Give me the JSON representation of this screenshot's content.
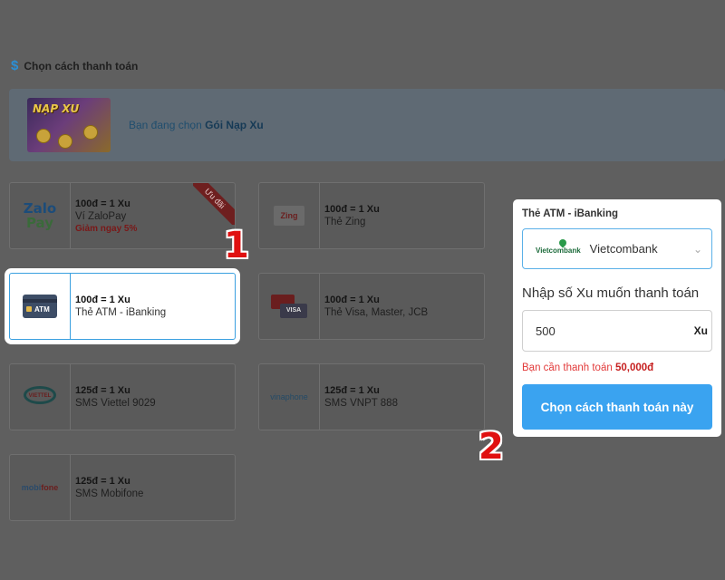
{
  "section": {
    "icon": "dollar-icon",
    "title": "Chọn cách thanh toán"
  },
  "banner": {
    "image_text": "NẠP XU",
    "text_prefix": "Bạn đang chọn",
    "package": "Gói Nạp Xu"
  },
  "methods": [
    {
      "id": "zalopay",
      "logo": "zalopay-logo",
      "logo_top": "Zalo",
      "logo_bottom": "Pay",
      "rate": "100đ = 1 Xu",
      "name": "Ví ZaloPay",
      "promo": "Giảm ngay 5%",
      "ribbon": "Ưu đãi",
      "selected": false
    },
    {
      "id": "zing",
      "logo": "zing-logo",
      "logo_text": "Zing",
      "rate": "100đ = 1 Xu",
      "name": "Thẻ Zing",
      "selected": false
    },
    {
      "id": "atm",
      "logo": "atm-card-icon",
      "logo_text": "ATM",
      "rate": "100đ = 1 Xu",
      "name": "Thẻ ATM - iBanking",
      "selected": true
    },
    {
      "id": "visa",
      "logo": "visa-mastercard-logo",
      "logo_text": "VISA",
      "rate": "100đ = 1 Xu",
      "name": "Thẻ Visa, Master, JCB",
      "selected": false
    },
    {
      "id": "viettel",
      "logo": "viettel-logo",
      "logo_text": "VIETTEL",
      "rate": "125đ = 1 Xu",
      "name": "SMS Viettel 9029",
      "selected": false
    },
    {
      "id": "vinaphone",
      "logo": "vinaphone-logo",
      "logo_text": "vinaphone",
      "rate": "125đ = 1 Xu",
      "name": "SMS VNPT 888",
      "selected": false
    },
    {
      "id": "mobifone",
      "logo": "mobifone-logo",
      "logo_text_a": "mobi",
      "logo_text_b": "fone",
      "rate": "125đ = 1 Xu",
      "name": "SMS Mobifone",
      "selected": false
    }
  ],
  "panel": {
    "title": "Thẻ ATM - iBanking",
    "bank_logo_text": "Vietcombank",
    "bank_name": "Vietcombank",
    "amount_label": "Nhập số Xu muốn thanh toán",
    "amount_value": "500",
    "amount_unit": "Xu",
    "need_pay_prefix": "Bạn cần thanh toán",
    "need_pay_amount": "50,000đ",
    "confirm_label": "Chọn cách thanh toán này"
  },
  "steps": {
    "one": "1",
    "two": "2"
  },
  "colors": {
    "accent": "#3aa3f0",
    "warning": "#e23a3a",
    "step_marker": "#e01010"
  }
}
